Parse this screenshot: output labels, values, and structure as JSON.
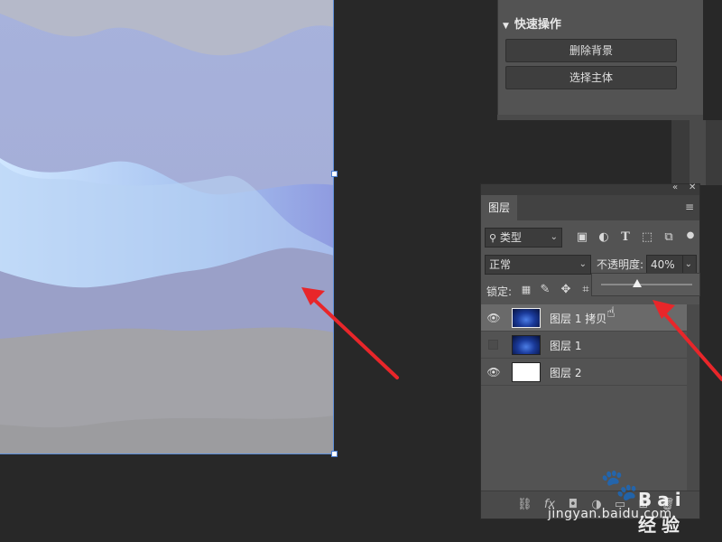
{
  "quick_actions": {
    "title": "快速操作",
    "buttons": [
      "删除背景",
      "选择主体"
    ]
  },
  "layers_panel": {
    "tab_label": "图层",
    "filter_kind": "类型",
    "blend_mode": "正常",
    "opacity_label": "不透明度:",
    "opacity_value": "40%",
    "opacity_slider_fraction": 0.4,
    "lock_label": "锁定:",
    "layers": [
      {
        "name": "图层 1 拷贝",
        "visible": true,
        "selected": true,
        "thumb": "blue-lightning"
      },
      {
        "name": "图层 1",
        "visible": false,
        "selected": false,
        "thumb": "blue-lightning"
      },
      {
        "name": "图层 2",
        "visible": true,
        "selected": false,
        "thumb": "white"
      }
    ],
    "bottom_icons": [
      "link-icon",
      "fx-icon",
      "mask-icon",
      "adjustment-icon",
      "group-icon",
      "new-layer-icon",
      "trash-icon"
    ],
    "fx_text": "fx"
  },
  "watermark": {
    "brand": "Bai 经验",
    "url": "jingyan.baidu.com"
  },
  "colors": {
    "app_bg": "#282828",
    "panel_bg": "#535353",
    "arrow": "#e8262a",
    "selection_border": "#5f8fd8"
  }
}
